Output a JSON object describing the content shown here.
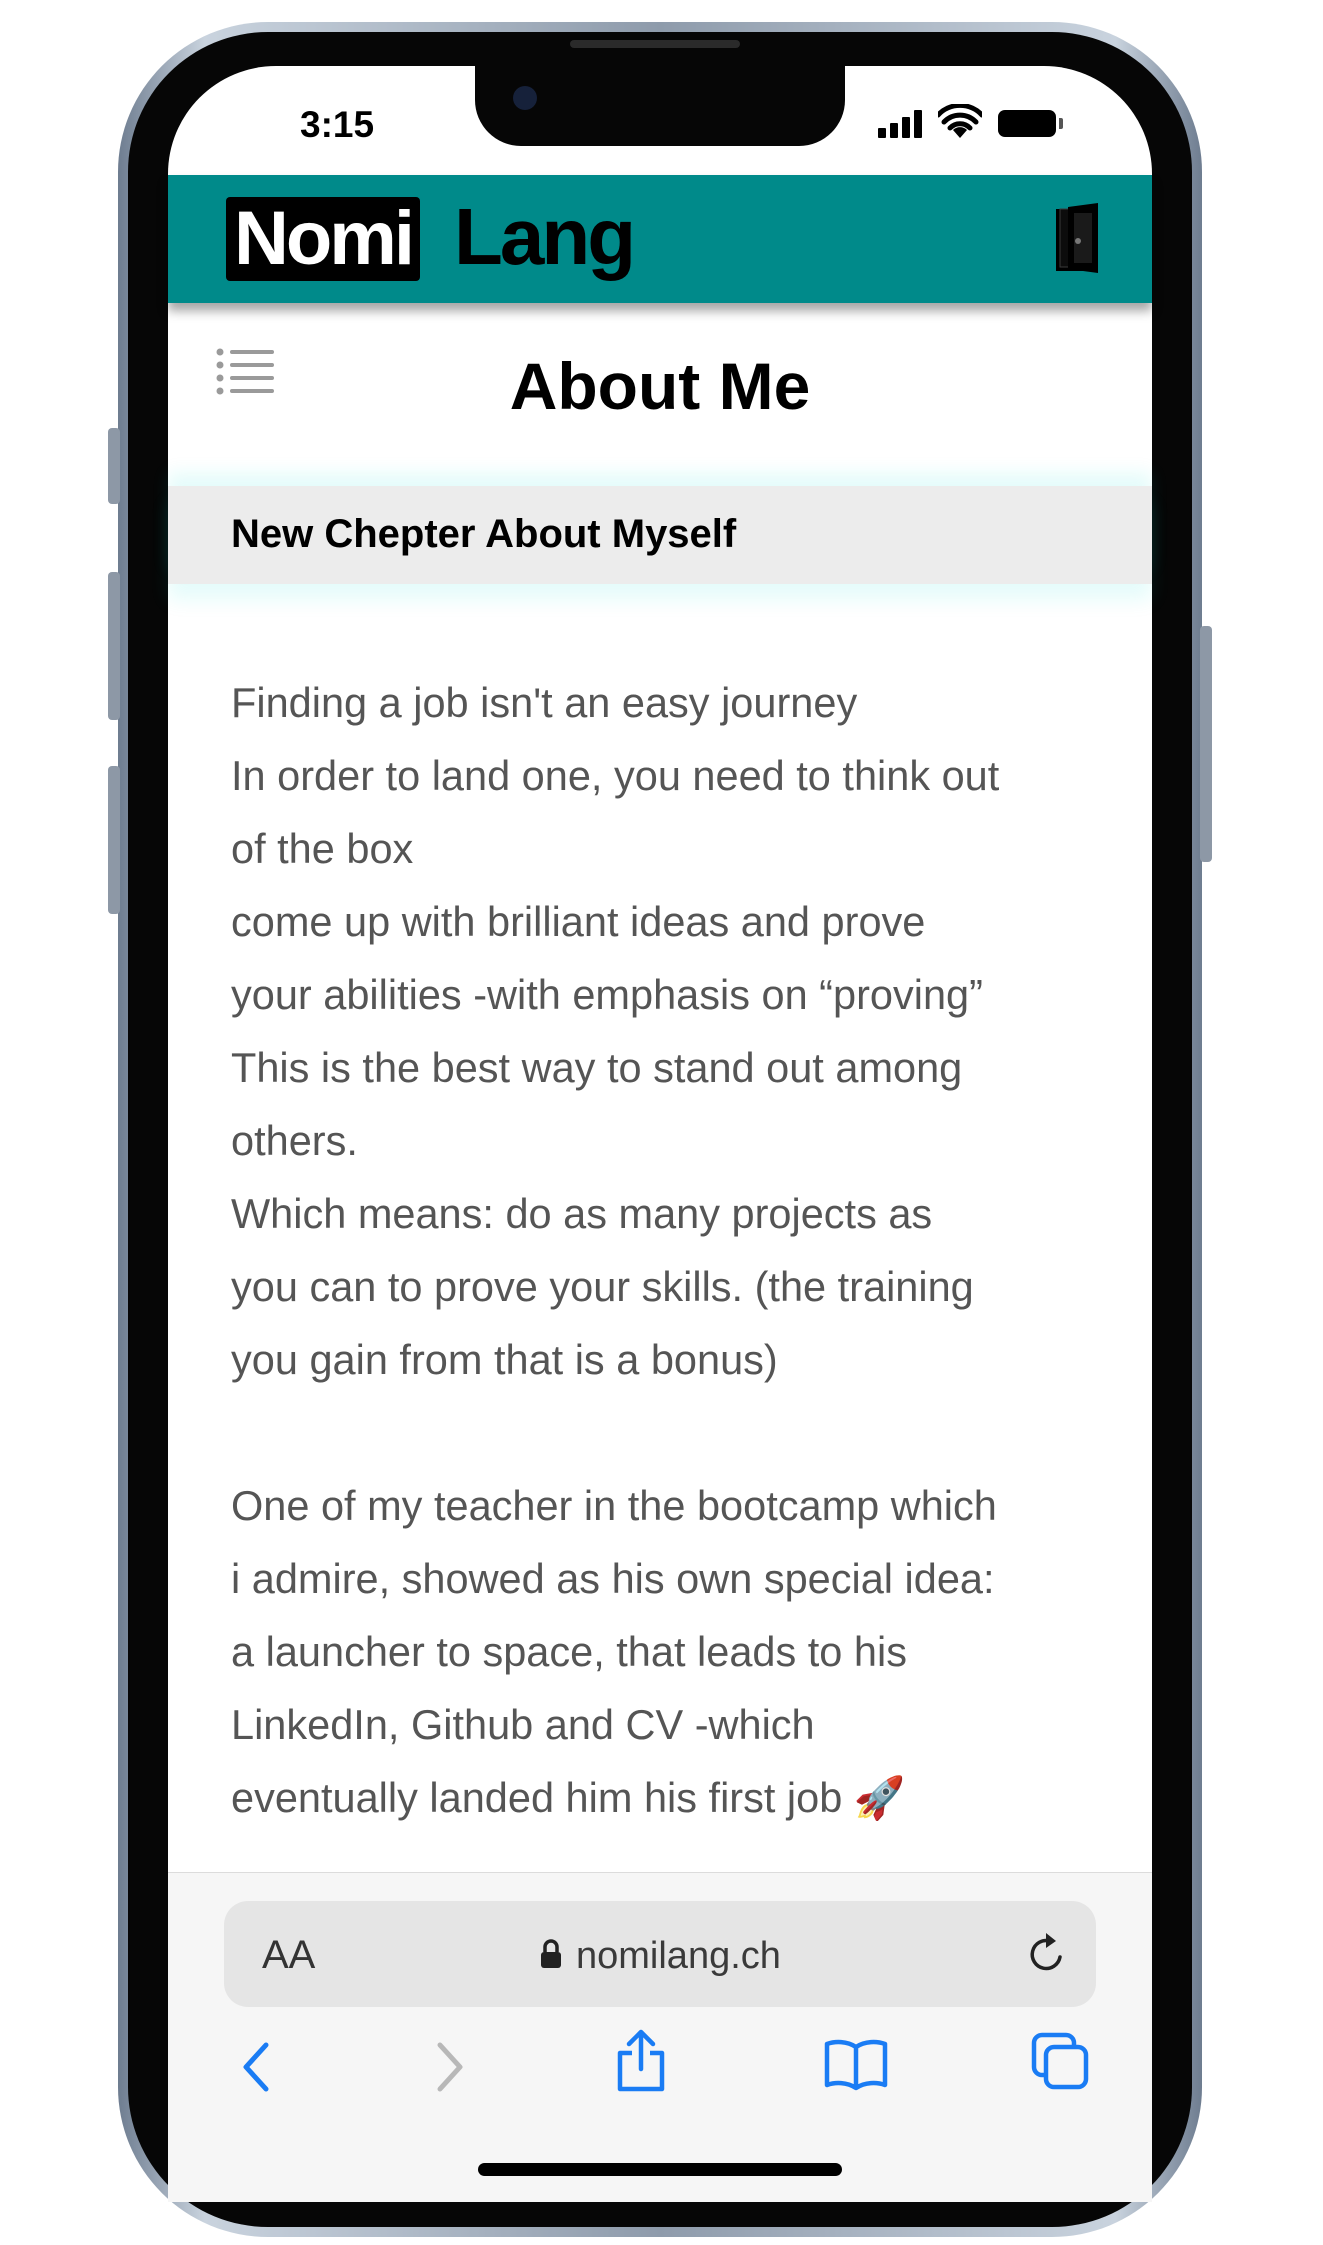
{
  "status_bar": {
    "time": "3:15",
    "icons": [
      "signal-icon",
      "wifi-icon",
      "battery-icon"
    ]
  },
  "header": {
    "logo_part1": "Nomi",
    "logo_part2": "Lang",
    "background": "#008a8a",
    "exit_icon": "door-icon"
  },
  "page": {
    "menu_icon": "list-menu-icon",
    "title": "About Me",
    "chapter_title": "New Chepter About Myself",
    "paragraphs": [
      {
        "lines": [
          "Finding a job isn't an easy journey",
          "In order to land one, you need to think out",
          "of the box",
          "come up with brilliant ideas and prove",
          "your abilities -with emphasis on “proving”",
          "This is the best way to stand out among",
          "others.",
          "Which means: do as many projects as",
          "you can to prove your skills. (the training",
          "you gain from that is a bonus)"
        ]
      },
      {
        "lines": [
          "One of my teacher in the bootcamp which",
          "i admire, showed as his own special idea:",
          "a launcher to space, that leads to his",
          "LinkedIn, Github and CV -which",
          "eventually landed him his first job 🚀"
        ]
      }
    ]
  },
  "browser": {
    "text_size_label": "AA",
    "url": "nomilang.ch",
    "accent_color": "#1a7cf4",
    "toolbar_icons": [
      "back-icon",
      "forward-icon",
      "share-icon",
      "bookmarks-icon",
      "tabs-icon"
    ]
  }
}
